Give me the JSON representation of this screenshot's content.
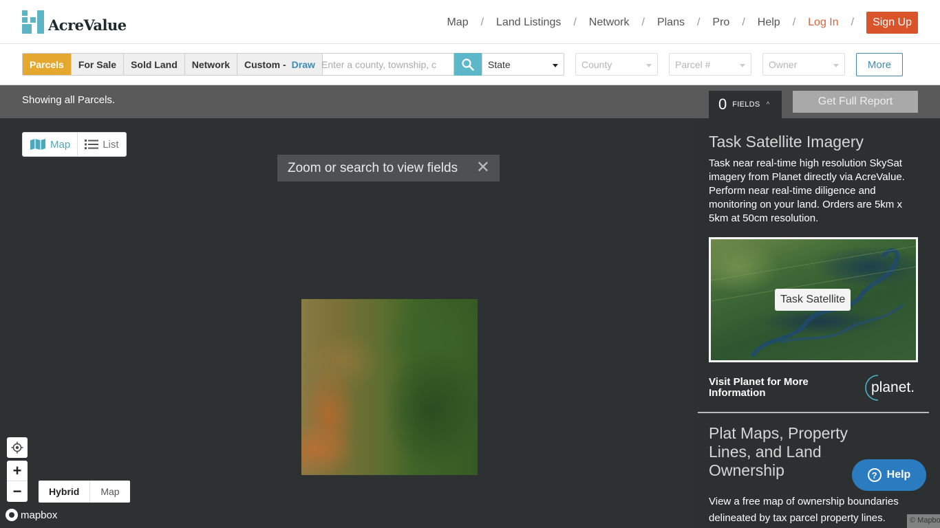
{
  "header": {
    "brand": "AcreValue",
    "nav": [
      "Map",
      "Land Listings",
      "Network",
      "Plans",
      "Pro",
      "Help"
    ],
    "separator": "/",
    "login": "Log In",
    "signup": "Sign Up"
  },
  "filters": {
    "tabs": [
      "Parcels",
      "For Sale",
      "Sold Land",
      "Network",
      "Custom -"
    ],
    "draw_label": "Draw",
    "search_placeholder": "Enter a county, township, c",
    "state_value": "State",
    "county_placeholder": "County",
    "parcel_placeholder": "Parcel #",
    "owner_placeholder": "Owner",
    "more_label": "More"
  },
  "status": {
    "text": "Showing all Parcels.",
    "fields_count": "0",
    "fields_label": "FIELDS",
    "report_label": "Get Full Report"
  },
  "map": {
    "view_map": "Map",
    "view_list": "List",
    "zoom_message": "Zoom or search to view fields",
    "basemap_hybrid": "Hybrid",
    "basemap_map": "Map",
    "attribution": "mapbox",
    "corner_text": "© Mapbox"
  },
  "panel": {
    "title": "Task Satellite Imagery",
    "description": "Task near real-time high resolution SkySat imagery from Planet directly via AcreValue. Perform near real-time diligence and monitoring on your land. Orders are 5km x 5km at 50cm resolution.",
    "image_button": "Task Satellite",
    "visit": "Visit Planet for More Information",
    "planet_logo": "planet.",
    "plat_title": "Plat Maps, Property Lines, and Land Ownership",
    "plat_desc": "View a free map of ownership boundaries delineated by tax parcel property lines."
  },
  "help": {
    "label": "Help"
  },
  "colors": {
    "accent": "#e5a82e",
    "teal": "#5cb8c9",
    "signup": "#d9532b",
    "help": "#2a7bbf"
  }
}
